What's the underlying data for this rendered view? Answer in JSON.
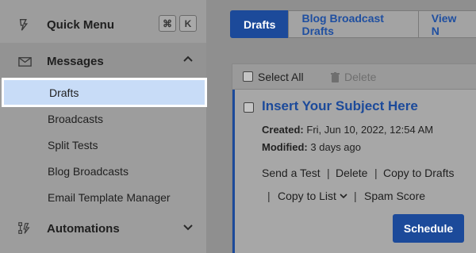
{
  "sidebar": {
    "quick_menu": {
      "label": "Quick Menu",
      "keys": [
        "⌘",
        "K"
      ]
    },
    "messages": {
      "label": "Messages",
      "items": [
        {
          "label": "Drafts",
          "active": true
        },
        {
          "label": "Broadcasts"
        },
        {
          "label": "Split Tests"
        },
        {
          "label": "Blog Broadcasts"
        },
        {
          "label": "Email Template Manager"
        }
      ]
    },
    "automations": {
      "label": "Automations"
    }
  },
  "tabs": [
    {
      "label": "Drafts",
      "active": true
    },
    {
      "label": "Blog Broadcast Drafts"
    },
    {
      "label": "View N"
    }
  ],
  "toolbar": {
    "select_all": "Select All",
    "delete": "Delete"
  },
  "draft": {
    "subject": "Insert Your Subject Here",
    "created_label": "Created:",
    "created_value": "Fri, Jun 10, 2022, 12:54 AM",
    "modified_label": "Modified:",
    "modified_value": "3 days ago",
    "actions": {
      "send_test": "Send a Test",
      "delete": "Delete",
      "copy_drafts": "Copy to Drafts",
      "copy_list": "Copy to List",
      "spam_score": "Spam Score",
      "separator": "|"
    },
    "schedule": "Schedule"
  },
  "colors": {
    "accent": "#1c4a9a",
    "active_item_bg": "#c8dcf7"
  }
}
